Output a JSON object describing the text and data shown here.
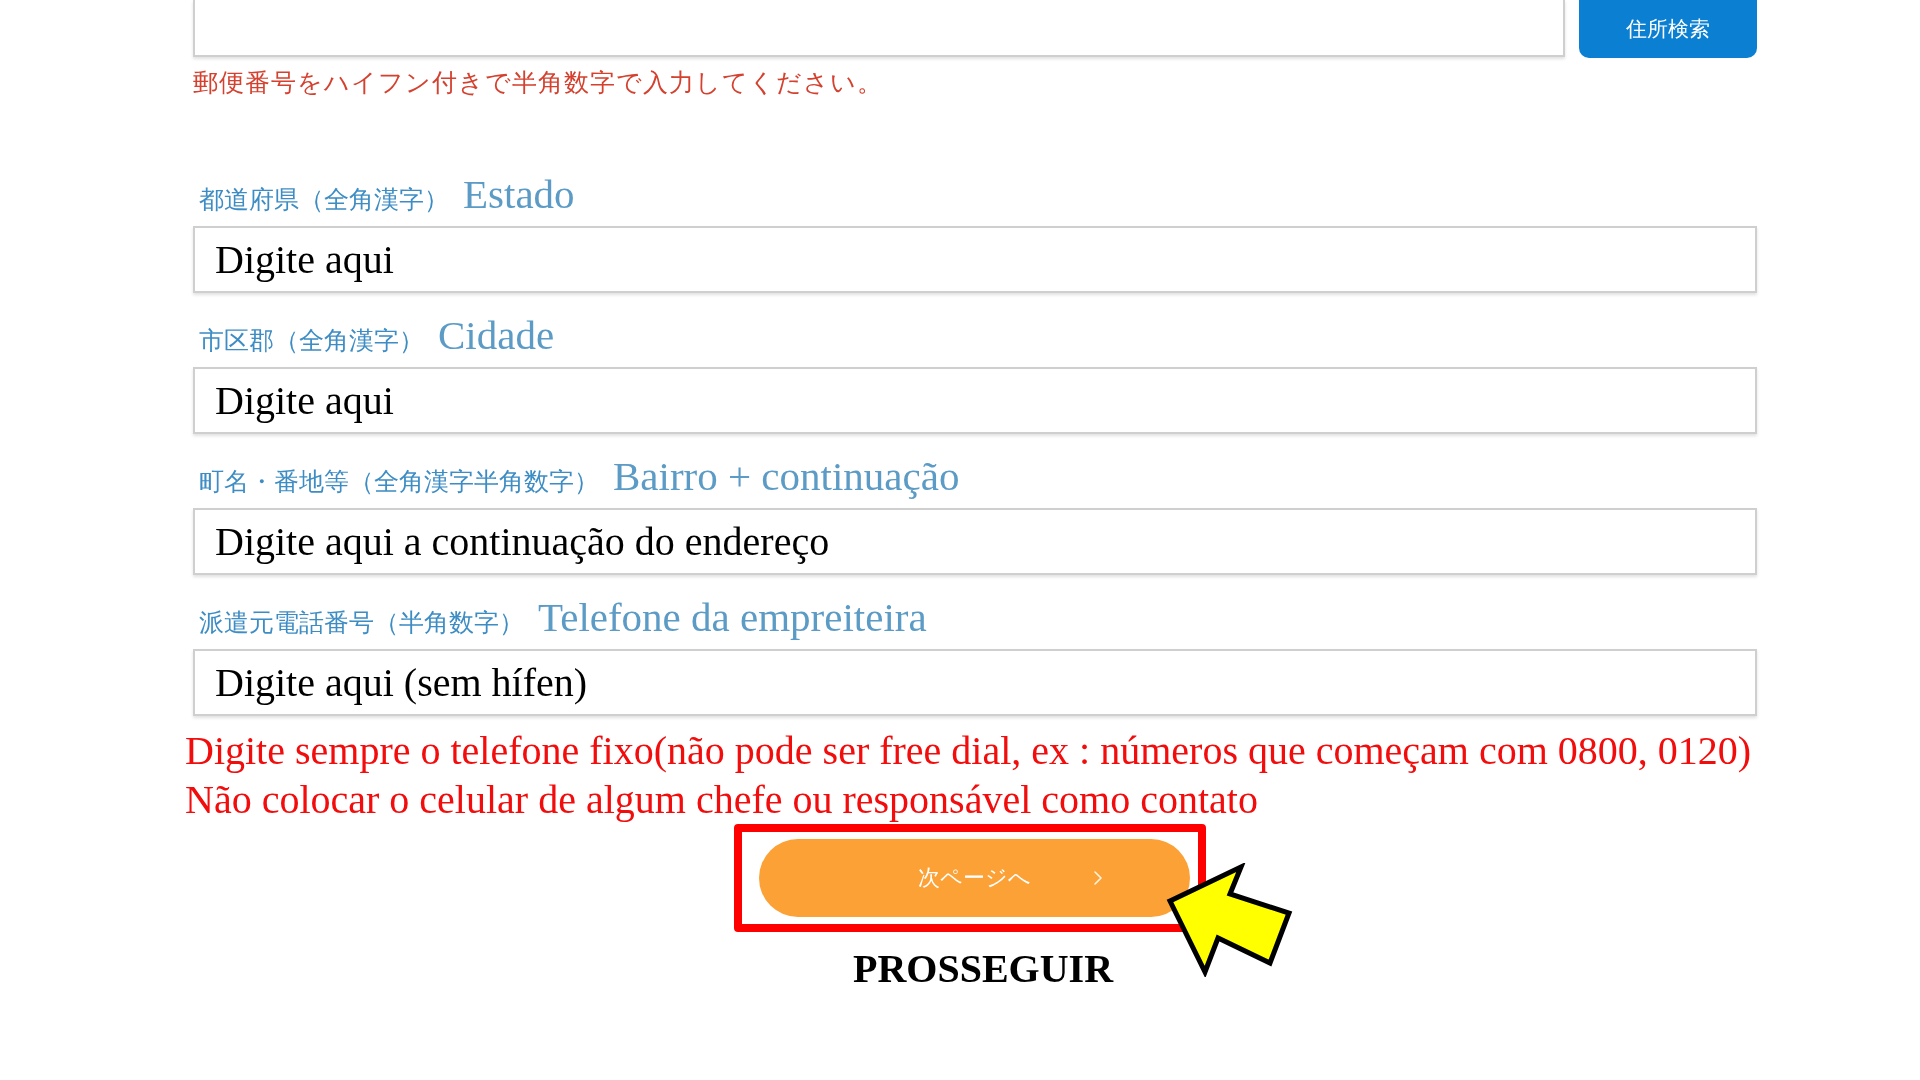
{
  "postal_code": {
    "search_button": "住所検索",
    "hint": "郵便番号をハイフン付きで半角数字で入力してください。"
  },
  "fields": [
    {
      "label": "都道府県（全角漢字）",
      "translation": "Estado",
      "placeholder": "Digite aqui"
    },
    {
      "label": "市区郡（全角漢字）",
      "translation": "Cidade",
      "placeholder": "Digite aqui"
    },
    {
      "label": "町名・番地等（全角漢字半角数字）",
      "translation": "Bairro + continuação",
      "placeholder": "Digite aqui a continuação do endereço"
    },
    {
      "label": "派遣元電話番号（半角数字）",
      "translation": "Telefone da empreiteira",
      "placeholder": "Digite aqui (sem hífen)"
    }
  ],
  "notes": [
    "Digite sempre o telefone fixo(não pode ser free dial, ex : números que começam com 0800, 0120)",
    "Não colocar o celular de algum chefe ou responsável como contato"
  ],
  "next_button": {
    "label": "次ページへ",
    "highlighted": true
  },
  "annotation": {
    "caption": "PROSSEGUIR"
  }
}
